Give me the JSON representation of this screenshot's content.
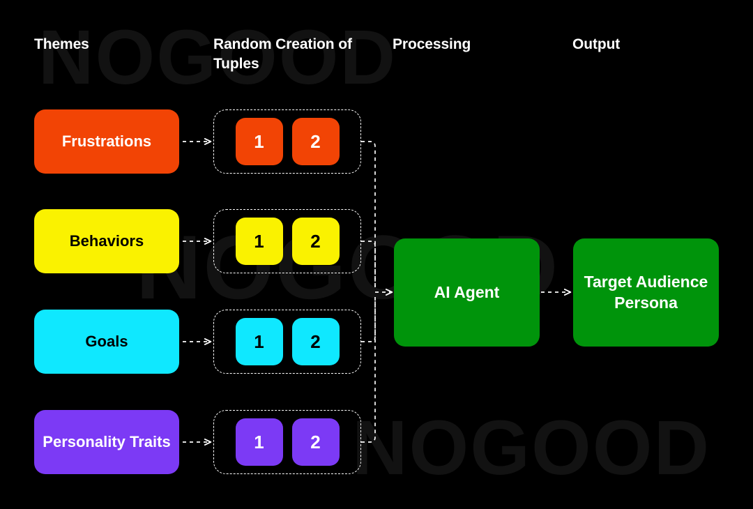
{
  "page": {
    "background_color": "#000000",
    "watermark_text": "NOGOOD",
    "watermark_color": "#121212"
  },
  "headers": {
    "themes": "Themes",
    "tuples": "Random Creation of Tuples",
    "processing": "Processing",
    "output": "Output"
  },
  "rows": [
    {
      "theme_label": "Frustrations",
      "color": "#F24405",
      "text_color": "#ffffff",
      "tuples": [
        "1",
        "2"
      ]
    },
    {
      "theme_label": "Behaviors",
      "color": "#FAF200",
      "text_color": "#000000",
      "tuples": [
        "1",
        "2"
      ]
    },
    {
      "theme_label": "Goals",
      "color": "#0FE8FF",
      "text_color": "#000000",
      "tuples": [
        "1",
        "2"
      ]
    },
    {
      "theme_label": "Personality Traits",
      "color": "#7C3AF5",
      "text_color": "#ffffff",
      "tuples": [
        "1",
        "2"
      ]
    }
  ],
  "processing": {
    "label": "AI Agent",
    "color": "#00940B",
    "text_color": "#ffffff"
  },
  "output": {
    "label": "Target Audience Persona",
    "color": "#00940B",
    "text_color": "#ffffff"
  },
  "connectors": {
    "line_color": "#ffffff",
    "style": "dashed"
  }
}
